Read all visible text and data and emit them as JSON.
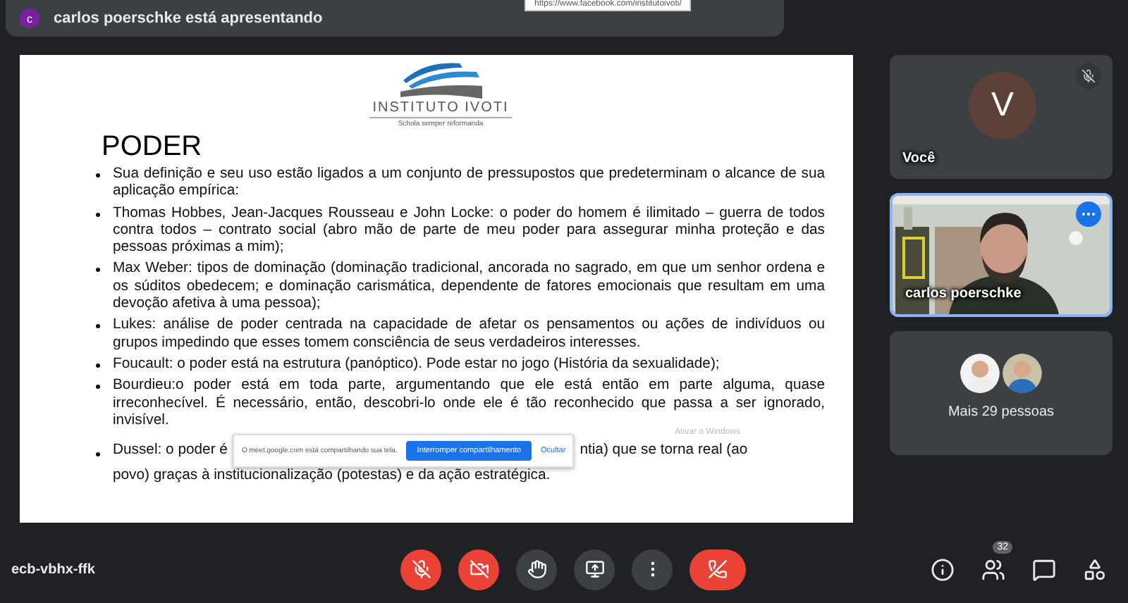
{
  "presenter_bar": {
    "avatar_letter": "c",
    "text": "carlos poerschke está apresentando"
  },
  "url_tooltip": {
    "text": "https://www.facebook.com/institutoivoti/"
  },
  "slide": {
    "logo_name": "INSTITUTO IVOTI",
    "logo_motto": "Schola semper reformanda",
    "title": "PODER",
    "bullets": [
      "Sua definição e seu uso estão ligados a um conjunto de pressupostos que predeterminam o alcance de sua aplicação empírica:",
      "Thomas Hobbes, Jean-Jacques Rousseau e John Locke: o poder do homem é ilimitado – guerra de todos contra todos – contrato social (abro mão de parte de meu poder para assegurar minha proteção e das pessoas próximas a mim);",
      "Max Weber: tipos de dominação (dominação tradicional, ancorada no sagrado, em que um senhor ordena e os súditos obedecem; e dominação carismática, dependente de fatores emocionais que resultam em uma devoção afetiva à uma pessoa);",
      "Lukes: análise de poder centrada na capacidade de afetar os pensamentos ou ações de indivíduos ou grupos impedindo que esses tomem consciência de seus verdadeiros interesses.",
      "Foucault: o poder está na estrutura (panóptico). Pode estar no jogo (História da sexualidade);",
      "Bourdieu:o poder está em toda parte, argumentando que ele está então em parte alguma, quase irreconhecível. É necessário, então, descobri-lo onde ele é tão reconhecido que passa a ser ignorado, invisível."
    ],
    "partial_bullet": {
      "start": "Dussel: o poder é",
      "end": "ntia) que se torna real (ao",
      "second_line": "povo) graças à institucionalização (potestas) e da ação estratégica."
    }
  },
  "share_notice": {
    "message": "O meet.google.com está compartilhando sua tela.",
    "stop_button": "Interromper compartilhamento",
    "hide_link": "Ocultar"
  },
  "os_watermark": "Ativar o Windows",
  "tiles": [
    {
      "kind": "avatar",
      "initial": "V",
      "name": "Você",
      "mic_muted": true,
      "selected": false
    },
    {
      "kind": "video",
      "name": "carlos poerschke",
      "selected": true
    },
    {
      "kind": "more",
      "label": "Mais 29 pessoas",
      "selected": false
    }
  ],
  "meeting_code": "ecb-vbhx-ffk",
  "controls": [
    {
      "kind": "mic",
      "muted": true
    },
    {
      "kind": "camera",
      "muted": true
    },
    {
      "kind": "hand"
    },
    {
      "kind": "present"
    },
    {
      "kind": "more"
    },
    {
      "kind": "end"
    }
  ],
  "side_buttons": [
    {
      "kind": "info"
    },
    {
      "kind": "people",
      "badge": "32"
    },
    {
      "kind": "chat"
    },
    {
      "kind": "activities"
    }
  ]
}
